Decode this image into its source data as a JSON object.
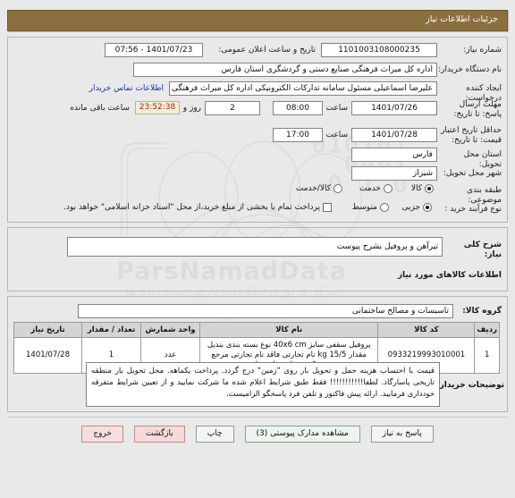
{
  "window": {
    "title": "جزئیات اطلاعات نیاز"
  },
  "watermark": {
    "digits": "010101\n0001\n0 1 0",
    "brand": "ParsNamadData",
    "fa_line1": "مرکز فراوری اطلاعات پارس نماد داده ها",
    "fa_line2": "پایگاه اطلاع رسانی مناقصه و مزایده",
    "fa_line3": "۰۲۱-۸۸۴۲۹۴۶۲"
  },
  "main": {
    "need_number_label": "شماره نیاز:",
    "need_number_value": "1101003108000235",
    "announce_label": "تاریخ و ساعت اعلان عمومی:",
    "announce_value": "1401/07/23 - 07:56",
    "buyer_org_label": "نام دستگاه خریدار:",
    "buyer_org_value": "اداره کل میراث فرهنگی  صنایع دستی و گردشگری استان فارس",
    "creator_label": "ایجاد کننده درخواست:",
    "creator_value": "علیرضا اسماعیلی مسئول سامانه تدارکات الکترونیکی اداره کل میراث فرهنگی",
    "contact_link": "اطلاعات تماس خریدار",
    "deadline_label": "مهلت ارسال پاسخ: تا تاریخ:",
    "deadline_date": "1401/07/26",
    "deadline_hour_label": "ساعت",
    "deadline_hour": "08:00",
    "remaining_days": "2",
    "remaining_days_label": "روز و",
    "remaining_timer": "23:52:38",
    "remaining_suffix": "ساعت باقی مانده",
    "validity_label": "حداقل تاریخ اعتبار قیمت: تا تاریخ:",
    "validity_date": "1401/07/28",
    "validity_hour_label": "ساعت",
    "validity_hour": "17:00",
    "province_label": "استان محل تحویل:",
    "province_value": "فارس",
    "city_label": "شهر محل تحویل:",
    "city_value": "شیراز",
    "classification_label": "طبقه بندی موضوعی:",
    "classification_options": [
      {
        "label": "کالا",
        "selected": true
      },
      {
        "label": "خدمت",
        "selected": false
      },
      {
        "label": "کالا/خدمت",
        "selected": false
      }
    ],
    "process_label": "نوع فرآیند خرید :",
    "process_options": [
      {
        "label": "جزیی",
        "selected": true
      },
      {
        "label": "متوسط",
        "selected": false
      }
    ],
    "treasury_checkbox_label": "پرداخت تمام یا بخشی از مبلغ خرید،از محل \"اسناد خزانه اسلامی\" خواهد بود.",
    "treasury_checked": false
  },
  "description": {
    "label": "شرح کلی نیاز:",
    "value": "تیرآهن و پروفیل بشرح پیوست",
    "goods_heading": "اطلاعات کالاهای مورد نیاز"
  },
  "goods": {
    "group_label": "گروه کالا:",
    "group_value": "تاسیسات و مصالح ساختمانی",
    "columns": [
      "ردیف",
      "کد کالا",
      "نام کالا",
      "واحد شمارش",
      "تعداد / مقدار",
      "تاریخ نیاز"
    ],
    "rows": [
      {
        "index": "1",
        "code": "0933219993010001",
        "name": "پروفیل سقفی سایز 40x6 cm نوع بسته بندی بندیل مقدار 15/5 kg نام تجارتی فاقد نام تجارتی مرجع عرضه کننده هادی دادوی اتوبی",
        "unit": "عدد",
        "quantity": "1",
        "need_date": "1401/07/28"
      }
    ]
  },
  "notes": {
    "label": "توضیحات خریدار:",
    "value": "قیمت با احتساب هزینه حمل و تحویل بار روی \"زمین\" درج گردد. پرداخت یکماهه. محل تحویل بار منطقه تاریخی پاسارگاد. لطفا!!!!!!!!!!! فقط طبق شرایط اعلام شده ما شرکت نمایید و از تعیین شرایط متفرقه خودداری فرمایید. ارائه پیش فاکتور و تلفن فرد پاسخگو الزامیست."
  },
  "footer": {
    "buttons": [
      {
        "id": "respond",
        "label": "پاسخ به نیاز",
        "style": "plain"
      },
      {
        "id": "attachments",
        "label": "مشاهده مدارک پیوستی (3)",
        "style": "green"
      },
      {
        "id": "print",
        "label": "چاپ",
        "style": "plain"
      },
      {
        "id": "back",
        "label": "بازگشت",
        "style": "pink2"
      },
      {
        "id": "exit",
        "label": "خروج",
        "style": "pink"
      }
    ]
  },
  "colors": {
    "titlebar": "#8b6f3f",
    "page_bg": "#e9e9e9",
    "countdown_text": "#b02020",
    "link": "#1133bb"
  }
}
